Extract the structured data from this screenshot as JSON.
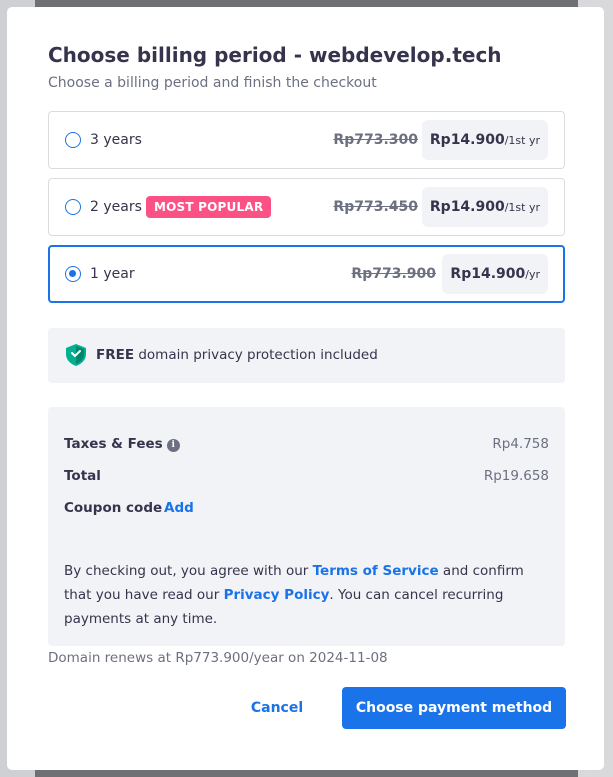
{
  "modal": {
    "title": "Choose billing period - webdevelop.tech",
    "subtitle": "Choose a billing period and finish the checkout"
  },
  "options": [
    {
      "label": "3 years",
      "badge": "",
      "old_price": "Rp773.300",
      "price": "Rp14.900",
      "period": "/1st yr",
      "selected": false
    },
    {
      "label": "2 years",
      "badge": "MOST POPULAR",
      "old_price": "Rp773.450",
      "price": "Rp14.900",
      "period": "/1st yr",
      "selected": false
    },
    {
      "label": "1 year",
      "badge": "",
      "old_price": "Rp773.900",
      "price": "Rp14.900",
      "period": "/yr",
      "selected": true
    }
  ],
  "privacy": {
    "bold": "FREE",
    "text": " domain privacy protection included"
  },
  "summary": {
    "taxes_label": "Taxes & Fees",
    "taxes_value": "Rp4.758",
    "total_label": "Total",
    "total_value": "Rp19.658",
    "coupon_label": "Coupon code",
    "coupon_link": "Add"
  },
  "agreement": {
    "part1": "By checking out, you agree with our ",
    "terms_link": "Terms of Service",
    "part2": " and confirm that you have read our ",
    "privacy_link": "Privacy Policy",
    "part3": ". You can cancel recurring payments at any time."
  },
  "renews_text": "Domain renews at Rp773.900/year on 2024-11-08",
  "buttons": {
    "cancel": "Cancel",
    "primary": "Choose payment method"
  },
  "colors": {
    "accent": "#1a73e8",
    "badge": "#fc5185",
    "shield": "#00b090",
    "panel": "#f2f3f6"
  }
}
